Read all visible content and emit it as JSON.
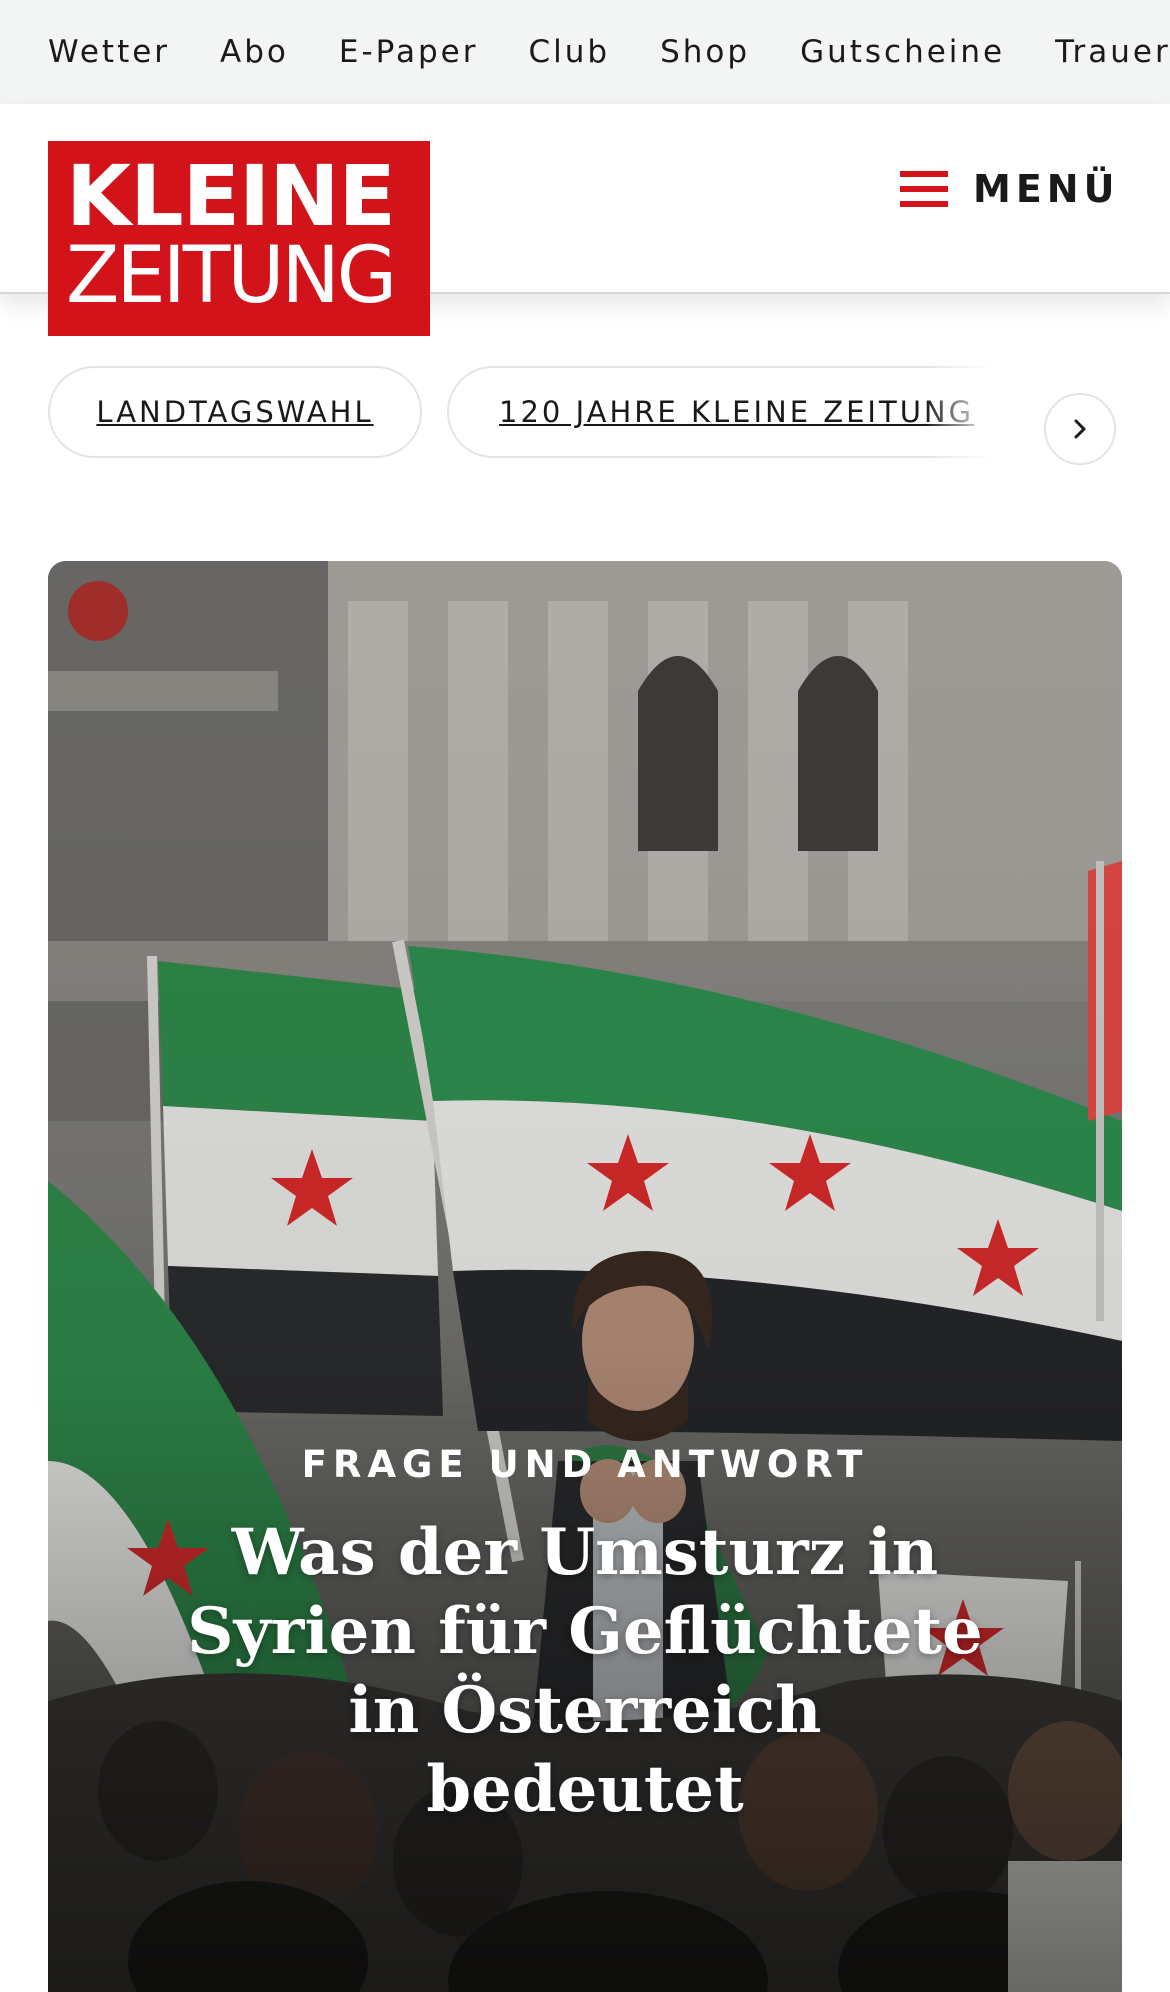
{
  "topbar": {
    "links": [
      "Wetter",
      "Abo",
      "E-Paper",
      "Club",
      "Shop",
      "Gutscheine",
      "Trauerportal"
    ]
  },
  "masthead": {
    "logo_line1": "KLEINE",
    "logo_line2": "ZEITUNG",
    "menu_label": "MENÜ",
    "menu_icon": "hamburger-icon"
  },
  "topics": {
    "chips": [
      "LANDTAGSWAHL",
      "120 JAHRE KLEINE ZEITUNG"
    ],
    "next_icon": "chevron-right-icon"
  },
  "hero": {
    "kicker": "FRAGE UND ANTWORT",
    "headline": "Was der Umsturz in Syrien für Geflüchtete in Österreich bedeutet"
  },
  "colors": {
    "brand_red": "#d2131a",
    "topbar_bg": "#f3f4f4",
    "text": "#1a1a1a"
  }
}
